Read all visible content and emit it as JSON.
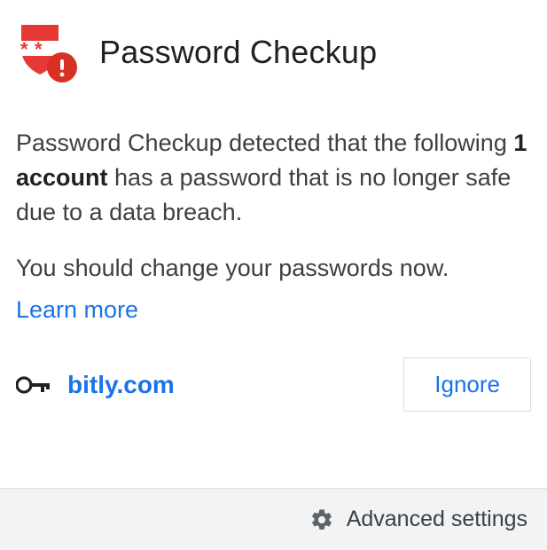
{
  "header": {
    "title": "Password Checkup",
    "icon": "password-shield-alert-icon"
  },
  "body": {
    "pre": "Password Checkup detected that the following ",
    "bold": "1 account",
    "post": " has a password that is no longer safe due to a data breach.",
    "advice": "You should change your passwords now.",
    "learn_more": "Learn more"
  },
  "accounts": [
    {
      "site": "bitly.com",
      "action": "Ignore"
    }
  ],
  "footer": {
    "advanced": "Advanced settings",
    "icon": "gear-icon"
  }
}
